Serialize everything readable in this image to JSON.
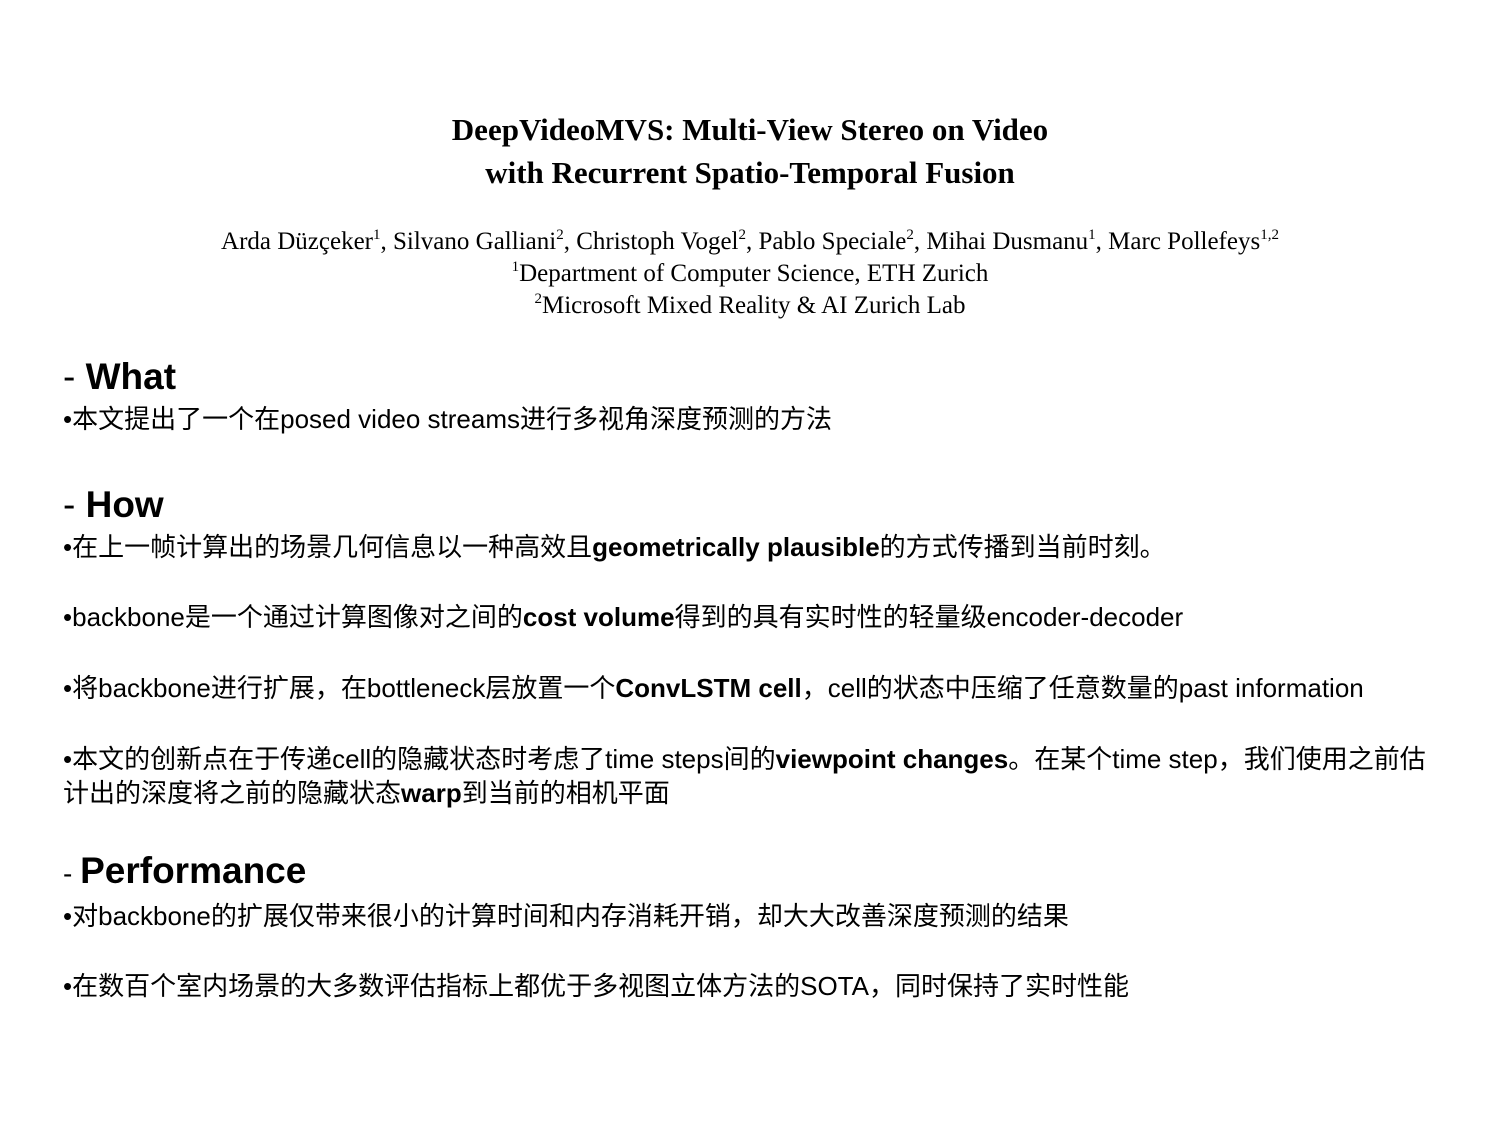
{
  "paper": {
    "title_line1": "DeepVideoMVS: Multi-View Stereo on Video",
    "title_line2": "with Recurrent Spatio-Temporal Fusion",
    "authors": [
      {
        "name": "Arda Düzçeker",
        "sup": "1",
        "sep": ", "
      },
      {
        "name": "Silvano Galliani",
        "sup": "2",
        "sep": ", "
      },
      {
        "name": "Christoph Vogel",
        "sup": "2",
        "sep": ", "
      },
      {
        "name": "Pablo Speciale",
        "sup": "2",
        "sep": ", "
      },
      {
        "name": "Mihai Dusmanu",
        "sup": "1",
        "sep": ", "
      },
      {
        "name": "Marc Pollefeys",
        "sup": "1,2",
        "sep": ""
      }
    ],
    "affiliations": [
      {
        "sup": "1",
        "text": "Department of Computer Science, ETH Zurich"
      },
      {
        "sup": "2",
        "text": "Microsoft Mixed Reality & AI Zurich Lab"
      }
    ]
  },
  "sections": {
    "what": {
      "dash": "- ",
      "heading": "What",
      "bullets": [
        {
          "a": "•本文提出了一个在posed video streams进行多视角深度预测的方法"
        }
      ]
    },
    "how": {
      "dash": "- ",
      "heading": "How",
      "bullets": [
        {
          "a": "•在上一帧计算出的场景几何信息以一种高效且",
          "b": "geometrically plausible",
          "c": "的方式传播到当前时刻。"
        },
        {
          "a": "•backbone是一个通过计算图像对之间的",
          "b": "cost volume",
          "c": "得到的具有实时性的轻量级encoder-decoder"
        },
        {
          "a": "•将backbone进行扩展，在bottleneck层放置一个",
          "b": "ConvLSTM cell",
          "c": "，cell的状态中压缩了任意数量的past information"
        },
        {
          "a": "•本文的创新点在于传递cell的隐藏状态时考虑了time steps间的",
          "b": "viewpoint changes",
          "c": "。在某个time step，我们使用之前估计出的深度将之前的隐藏状态",
          "d": "warp",
          "e": "到当前的相机平面"
        }
      ]
    },
    "performance": {
      "dash": "- ",
      "heading": "Performance",
      "bullets": [
        {
          "a": "•对backbone的扩展仅带来很小的计算时间和内存消耗开销，却大大改善深度预测的结果"
        },
        {
          "a": "•在数百个室内场景的大多数评估指标上都优于多视图立体方法的SOTA，同时保持了实时性能"
        }
      ]
    }
  }
}
